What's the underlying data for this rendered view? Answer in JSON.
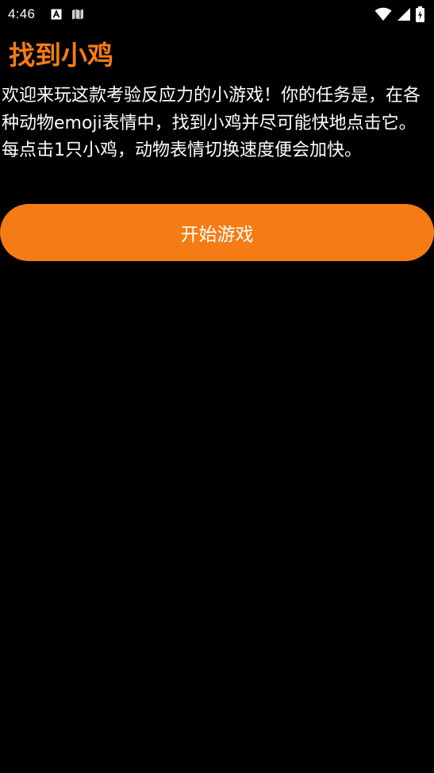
{
  "status_bar": {
    "time": "4:46",
    "left_icons": [
      "font-notification-icon",
      "map-notification-icon"
    ],
    "right_icons": [
      "wifi-icon",
      "cell-signal-icon",
      "battery-charging-icon"
    ]
  },
  "app": {
    "title": "找到小鸡",
    "description": "欢迎来玩这款考验反应力的小游戏！你的任务是，在各种动物emoji表情中，找到小鸡并尽可能快地点击它。每点击1只小鸡，动物表情切换速度便会加快。",
    "start_button_label": "开始游戏"
  },
  "colors": {
    "accent": "#f57c14",
    "background": "#000000",
    "text": "#ffffff"
  }
}
